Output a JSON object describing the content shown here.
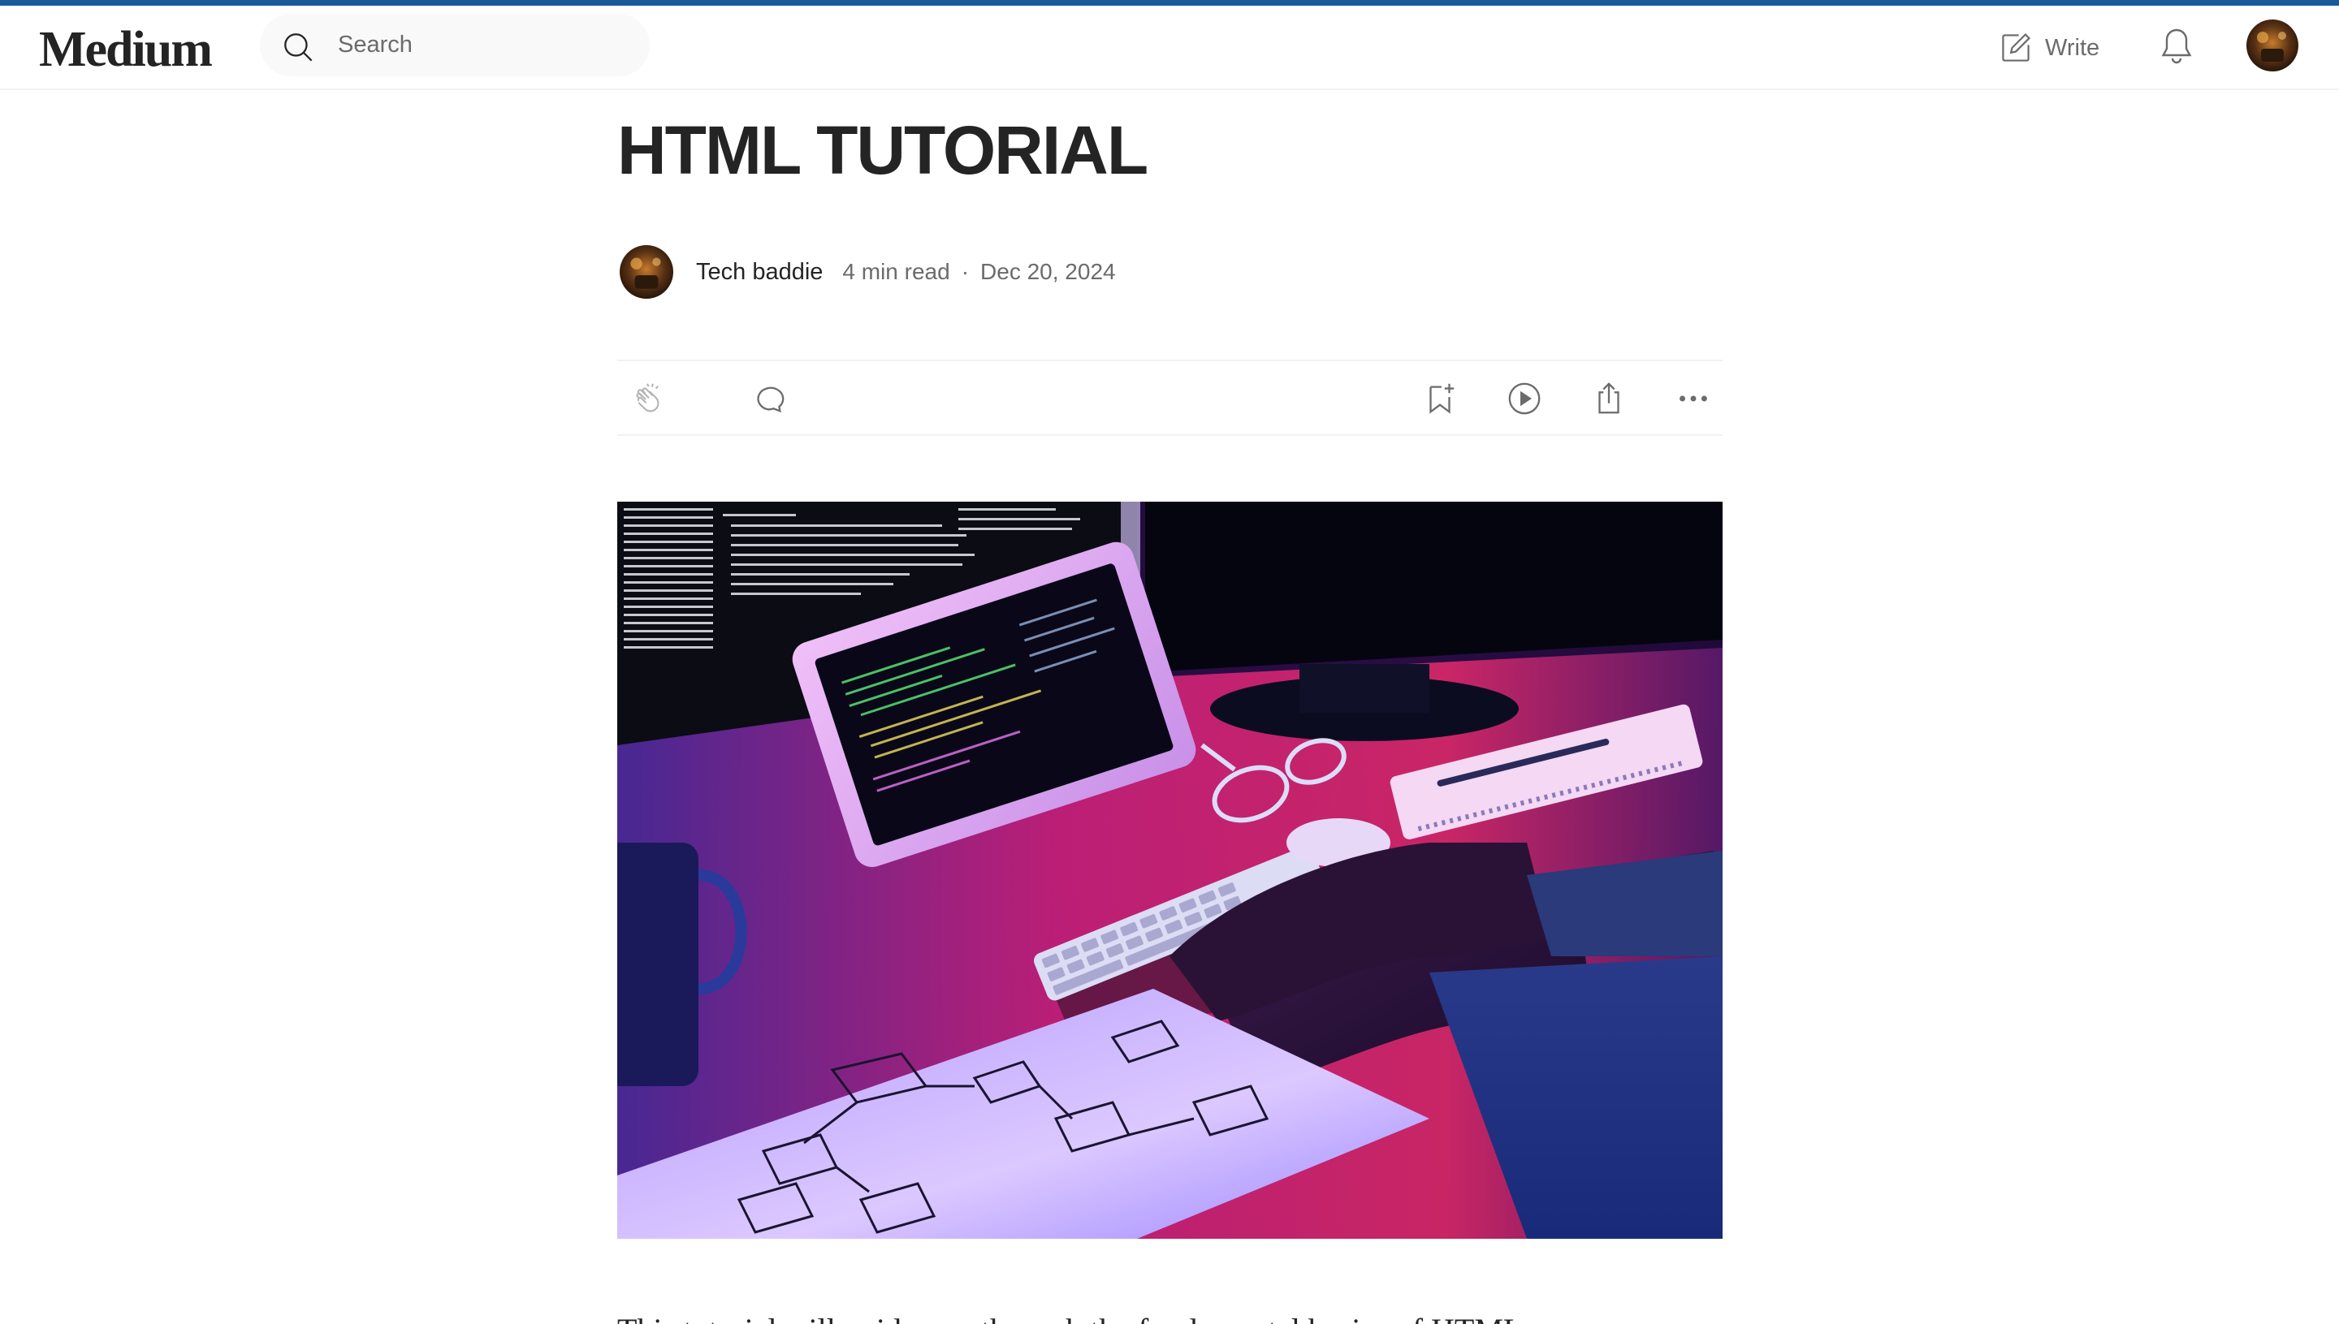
{
  "nav": {
    "logo": "Medium",
    "search_placeholder": "Search",
    "write_label": "Write"
  },
  "article": {
    "title": "HTML TUTORIAL",
    "author": "Tech baddie",
    "read_time": "4 min read",
    "separator": "·",
    "date": "Dec 20, 2024",
    "body_preview": "This tutorial will guide you through the fundamental basics of HTML"
  },
  "colors": {
    "top_strip": "#1a5a9a",
    "text_primary": "#242424",
    "text_secondary": "#6b6b6b",
    "search_bg": "#f9f9f9"
  },
  "icons": [
    "search-icon",
    "write-icon",
    "bell-icon",
    "clap-icon",
    "comment-icon",
    "bookmark-add-icon",
    "play-icon",
    "share-icon",
    "more-icon"
  ]
}
